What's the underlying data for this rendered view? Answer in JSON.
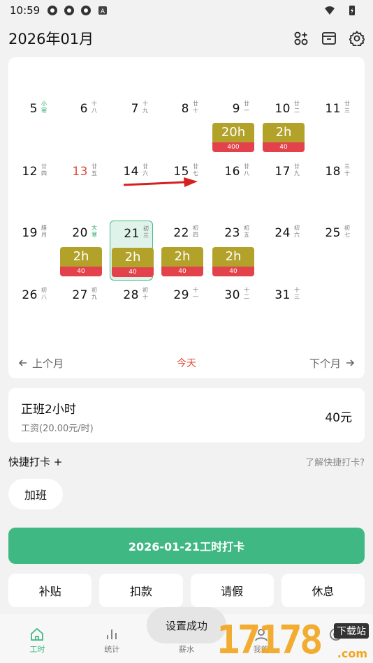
{
  "status": {
    "time": "10:59",
    "icons": [
      "app-icon",
      "app-icon",
      "app-icon",
      "a-icon"
    ],
    "right_icons": [
      "wifi-icon",
      "battery-icon"
    ]
  },
  "header": {
    "title": "2026年01月",
    "icons": [
      "grid-plus-icon",
      "archive-icon",
      "gear-icon"
    ]
  },
  "calendar": {
    "days": [
      {
        "num": "5",
        "lunar": "小寒",
        "lunar_green": true
      },
      {
        "num": "6",
        "lunar": "十八"
      },
      {
        "num": "7",
        "lunar": "十九"
      },
      {
        "num": "8",
        "lunar": "廿十"
      },
      {
        "num": "9",
        "lunar": "廿一",
        "hours": "20h",
        "pay": "400"
      },
      {
        "num": "10",
        "lunar": "廿二",
        "hours": "2h",
        "pay": "40"
      },
      {
        "num": "11",
        "lunar": "廿三"
      },
      {
        "num": "12",
        "lunar": "廿四"
      },
      {
        "num": "13",
        "lunar": "廿五",
        "red": true
      },
      {
        "num": "14",
        "lunar": "廿六"
      },
      {
        "num": "15",
        "lunar": "廿七"
      },
      {
        "num": "16",
        "lunar": "廿八"
      },
      {
        "num": "17",
        "lunar": "廿九"
      },
      {
        "num": "18",
        "lunar": "三十"
      },
      {
        "num": "19",
        "lunar": "腊月"
      },
      {
        "num": "20",
        "lunar": "大寒",
        "lunar_green": true,
        "hours": "2h",
        "pay": "40"
      },
      {
        "num": "21",
        "lunar": "初三",
        "hours": "2h",
        "pay": "40",
        "selected": true
      },
      {
        "num": "22",
        "lunar": "初四",
        "hours": "2h",
        "pay": "40"
      },
      {
        "num": "23",
        "lunar": "初五",
        "hours": "2h",
        "pay": "40"
      },
      {
        "num": "24",
        "lunar": "初六"
      },
      {
        "num": "25",
        "lunar": "初七"
      },
      {
        "num": "26",
        "lunar": "初八"
      },
      {
        "num": "27",
        "lunar": "初九"
      },
      {
        "num": "28",
        "lunar": "初十"
      },
      {
        "num": "29",
        "lunar": "十一"
      },
      {
        "num": "30",
        "lunar": "十二"
      },
      {
        "num": "31",
        "lunar": "十三"
      }
    ],
    "nav": {
      "prev": "上个月",
      "today": "今天",
      "next": "下个月"
    }
  },
  "summary": {
    "title": "正班2小时",
    "sub": "工资(20.00元/时)",
    "amount": "40元"
  },
  "quick": {
    "label": "快捷打卡 +",
    "help": "了解快捷打卡?",
    "chip": "加班"
  },
  "punch_button": "2026-01-21工时打卡",
  "actions": [
    "补贴",
    "扣款",
    "请假",
    "休息"
  ],
  "bottom_nav": [
    {
      "label": "工时",
      "icon": "home-icon",
      "active": true
    },
    {
      "label": "统计",
      "icon": "bar-chart-icon"
    },
    {
      "label": "薪水",
      "icon": "money-icon"
    },
    {
      "label": "我的",
      "icon": "person-icon"
    },
    {
      "label": "",
      "icon": "settings-icon"
    }
  ],
  "toast": "设置成功",
  "watermark": {
    "num": "17178",
    "tag": "下载站",
    "suffix": ".com"
  },
  "colors": {
    "accent": "#3fb883",
    "badge_gold": "#b3a22a",
    "badge_red": "#e3424c",
    "holiday_red": "#e04a3a"
  }
}
